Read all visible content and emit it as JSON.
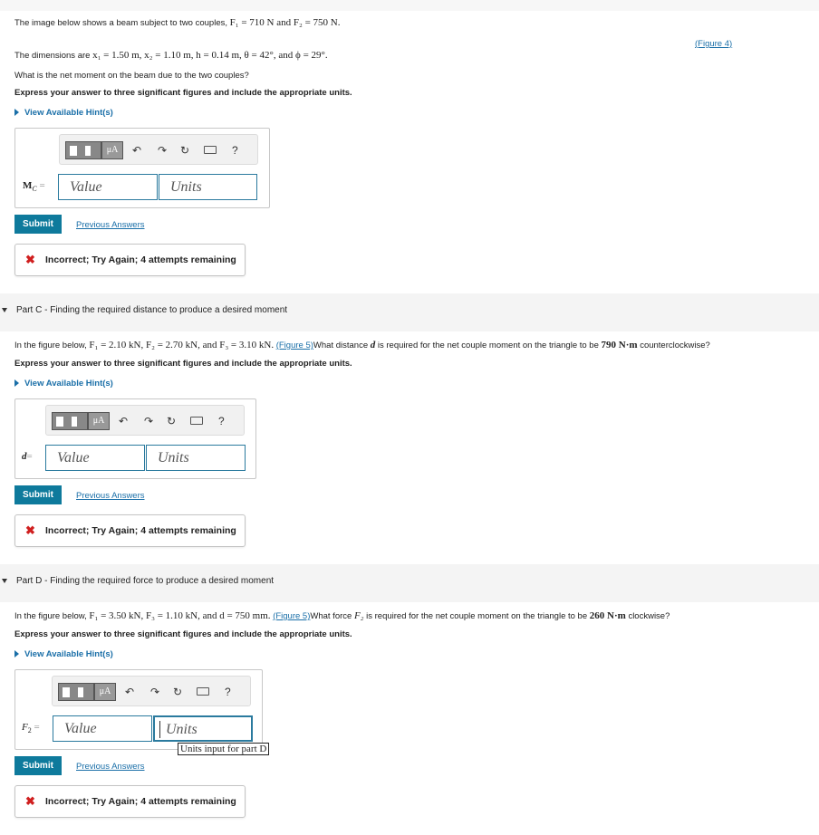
{
  "partB": {
    "intro": "The image below shows a beam subject to two couples,",
    "intro_vals": "F₁ = 710 N and F₂ = 750 N.",
    "figure_link": "(Figure 4)",
    "dims_prefix": "The dimensions are",
    "dims_vals": "x₁ = 1.50 m, x₂ = 1.10 m, h = 0.14 m, θ = 42°, and ϕ = 29°.",
    "question": "What is the net moment on the beam due to the two couples?",
    "instruction": "Express your answer to three significant figures and include the appropriate units.",
    "hint": "View Available Hint(s)",
    "var_label": "M",
    "var_sub": "C",
    "equals": "=",
    "value_placeholder": "Value",
    "units_placeholder": "Units",
    "submit": "Submit",
    "previous": "Previous Answers",
    "feedback": "Incorrect; Try Again; 4 attempts remaining"
  },
  "partC": {
    "title": "Part C - Finding the required distance to produce a desired moment",
    "text_prefix": "In the figure below,",
    "text_vals": "F₁ = 2.10 kN, F₂ = 2.70 kN, and F₃ = 3.10 kN.",
    "figure_link": "(Figure 5)",
    "text_mid": "What distance",
    "text_var": "d",
    "text_mid2": "is required for the net couple moment on the triangle to be",
    "text_moment": "790 N·m",
    "text_end": "counterclockwise?",
    "instruction": "Express your answer to three significant figures and include the appropriate units.",
    "hint": "View Available Hint(s)",
    "var_label": "d",
    "equals": "=",
    "value_placeholder": "Value",
    "units_placeholder": "Units",
    "submit": "Submit",
    "previous": "Previous Answers",
    "feedback": "Incorrect; Try Again; 4 attempts remaining"
  },
  "partD": {
    "title": "Part D - Finding the required force to produce a desired moment",
    "text_prefix": "In the figure below,",
    "text_vals": "F₁ = 3.50 kN, F₃ = 1.10 kN, and d = 750 mm.",
    "figure_link": "(Figure 5)",
    "text_mid": "What force",
    "text_var": "F₂",
    "text_mid2": "is required for the net couple moment on the triangle to be",
    "text_moment": "260 N·m",
    "text_end": "clockwise?",
    "instruction": "Express your answer to three significant figures and include the appropriate units.",
    "hint": "View Available Hint(s)",
    "var_label": "F",
    "var_sub": "2",
    "equals": "=",
    "value_placeholder": "Value",
    "units_placeholder": "Units",
    "units_tooltip": "Units input for part D",
    "submit": "Submit",
    "previous": "Previous Answers",
    "feedback": "Incorrect; Try Again; 4 attempts remaining"
  },
  "toolbar": {
    "mu_label": "μA",
    "undo_icon": "undo-icon",
    "redo_icon": "redo-icon",
    "reset_icon": "reset-icon",
    "keyboard_icon": "keyboard-icon",
    "help_label": "?"
  },
  "colors": {
    "accent": "#0e7a9c",
    "link": "#1a6fa8",
    "error": "#d01f1f"
  }
}
